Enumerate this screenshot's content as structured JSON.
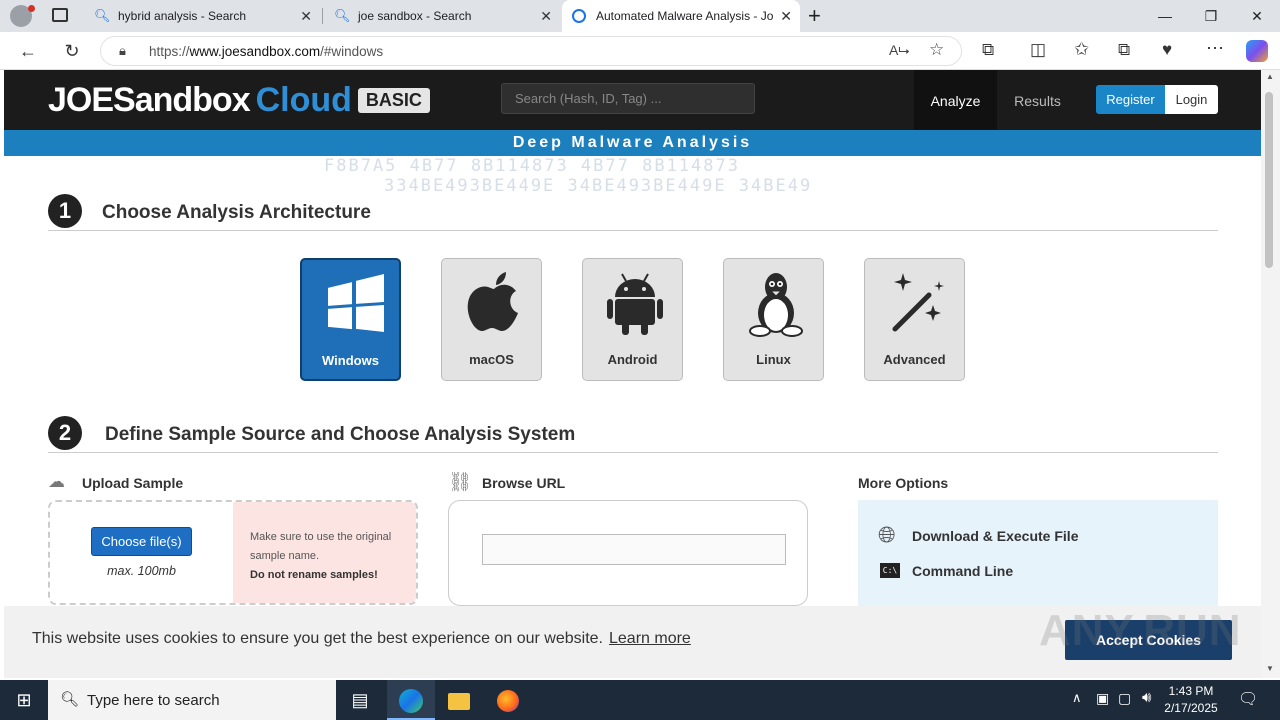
{
  "browser": {
    "tabs": [
      {
        "title": "hybrid analysis - Search"
      },
      {
        "title": "joe sandbox - Search"
      },
      {
        "title": "Automated Malware Analysis - Jo"
      }
    ],
    "url_prefix": "https://",
    "url_domain": "www.joesandbox.com",
    "url_path": "/#windows",
    "new_tab": "+"
  },
  "site": {
    "logo_main": "JOESandbox",
    "logo_cloud": "Cloud",
    "logo_badge": "BASIC",
    "search_placeholder": "Search (Hash, ID, Tag) ...",
    "nav": {
      "analyze": "Analyze",
      "results": "Results",
      "register": "Register",
      "login": "Login"
    },
    "banner": "Deep Malware Analysis",
    "hex_deco_1": "F8B7A5 4B77 8B114873 4B77 8B114873",
    "hex_deco_2": "334BE493BE449E 34BE493BE449E 34BE49"
  },
  "step1": {
    "number": "1",
    "title": "Choose Analysis Architecture",
    "architectures": [
      {
        "label": "Windows",
        "icon": "windows-icon",
        "selected": true
      },
      {
        "label": "macOS",
        "icon": "apple-icon",
        "selected": false
      },
      {
        "label": "Android",
        "icon": "android-icon",
        "selected": false
      },
      {
        "label": "Linux",
        "icon": "linux-icon",
        "selected": false
      },
      {
        "label": "Advanced",
        "icon": "magic-wand-icon",
        "selected": false
      }
    ]
  },
  "step2": {
    "number": "2",
    "title": "Define Sample Source and Choose Analysis System",
    "upload": {
      "label": "Upload Sample",
      "button": "Choose file(s)",
      "max": "max. 100mb",
      "note": "Make sure to use the original sample name.",
      "note_bold": "Do not rename samples!"
    },
    "browse": {
      "label": "Browse URL",
      "value": ""
    },
    "more": {
      "label": "More Options",
      "download_execute": "Download & Execute File",
      "command_line": "Command Line"
    }
  },
  "cookie": {
    "text": "This website uses cookies to ensure you get the best experience on our website.",
    "link": "Learn more",
    "button": "Accept Cookies"
  },
  "watermark": "ANY.RUN",
  "taskbar": {
    "search_placeholder": "Type here to search",
    "time": "1:43 PM",
    "date": "2/17/2025"
  },
  "colors": {
    "accent": "#1c7fbe",
    "selected_arch": "#1e6fb8",
    "header": "#1b1b1b"
  }
}
